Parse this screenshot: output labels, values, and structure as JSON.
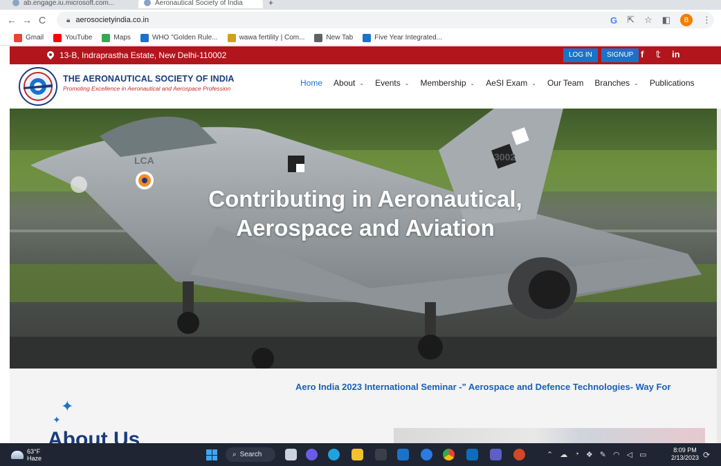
{
  "browser": {
    "tabs": [
      {
        "label": "ab.engage.iu.microsoft.com..."
      },
      {
        "label": "Aeronautical Society of India"
      }
    ],
    "new_tab_symbol": "+",
    "url": "aerosocietyindia.co.in",
    "profile_initial": "B",
    "bookmarks": [
      {
        "label": "Gmail",
        "icon": "gmail-icon",
        "color": "#ea4335"
      },
      {
        "label": "YouTube",
        "icon": "youtube-icon",
        "color": "#ff0000"
      },
      {
        "label": "Maps",
        "icon": "maps-icon",
        "color": "#34a853"
      },
      {
        "label": "WHO \"Golden Rule...",
        "icon": "who-icon",
        "color": "#1a73c9"
      },
      {
        "label": "wawa fertility | Com...",
        "icon": "wawa-icon",
        "color": "#d4a017"
      },
      {
        "label": "New Tab",
        "icon": "globe-icon",
        "color": "#5f6368"
      },
      {
        "label": "Five Year Integrated...",
        "icon": "five-year-icon",
        "color": "#1a73c9"
      }
    ]
  },
  "site": {
    "address": "13-B, Indraprastha Estate, New Delhi-110002",
    "login_label": "LOG IN",
    "signup_label": "SIGNUP",
    "social": {
      "facebook": "f",
      "twitter": "𝕥",
      "linkedin": "in"
    },
    "org_name": "THE AERONAUTICAL SOCIETY OF INDIA",
    "tagline": "Promoting Excellence in Aeronautical and Aerospace Profession",
    "nav": [
      {
        "label": "Home",
        "dropdown": false,
        "active": true
      },
      {
        "label": "About",
        "dropdown": true,
        "active": false
      },
      {
        "label": "Events",
        "dropdown": true,
        "active": false
      },
      {
        "label": "Membership",
        "dropdown": true,
        "active": false
      },
      {
        "label": "AeSI Exam",
        "dropdown": true,
        "active": false
      },
      {
        "label": "Our Team",
        "dropdown": false,
        "active": false
      },
      {
        "label": "Branches",
        "dropdown": true,
        "active": false
      },
      {
        "label": "Publications",
        "dropdown": false,
        "active": false
      }
    ],
    "hero_line1": "Contributing in Aeronautical,",
    "hero_line2": "Aerospace and Aviation",
    "aircraft_marking": "LCA",
    "aircraft_tail_number": "3002",
    "ticker": "Aero India 2023 International Seminar -\" Aerospace and Defence Technologies- Way For",
    "about_heading": "About Us"
  },
  "taskbar": {
    "weather_temp": "63°F",
    "weather_desc": "Haze",
    "search_label": "Search",
    "time": "8:09 PM",
    "date": "2/13/2023",
    "colors": {
      "accent_red": "#b3151c",
      "accent_blue": "#1a73c9"
    }
  }
}
